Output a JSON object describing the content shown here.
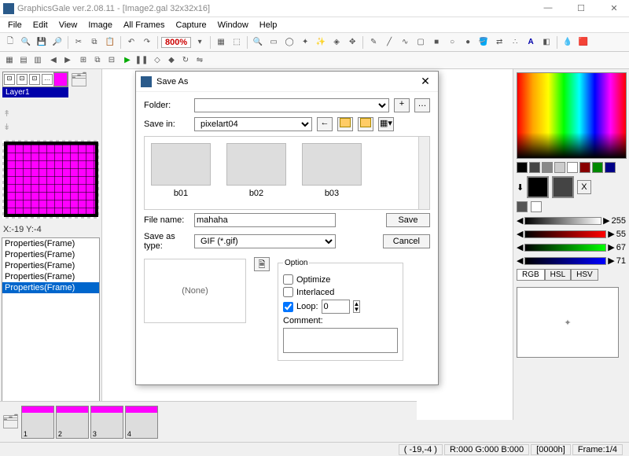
{
  "app": {
    "title": "GraphicsGale ver.2.08.11 - [Image2.gal 32x32x16]"
  },
  "menu": [
    "File",
    "Edit",
    "View",
    "Image",
    "All Frames",
    "Capture",
    "Window",
    "Help"
  ],
  "zoom": "800%",
  "coord": "X:-19 Y:-4",
  "layer": {
    "name": "Layer1"
  },
  "properties": [
    "Properties(Frame)",
    "Properties(Frame)",
    "Properties(Frame)",
    "Properties(Frame)",
    "Properties(Frame)"
  ],
  "frames": [
    "1",
    "2",
    "3",
    "4"
  ],
  "sliders": {
    "v1": "255",
    "v2": "55",
    "v3": "67",
    "v4": "71"
  },
  "colortabs": [
    "RGB",
    "HSL",
    "HSV"
  ],
  "status": {
    "pos": "( -19,-4 )",
    "rgb": "R:000 G:000 B:000",
    "time": "[0000h]",
    "frame": "Frame:1/4"
  },
  "dialog": {
    "title": "Save As",
    "folder_label": "Folder:",
    "savein_label": "Save in:",
    "savein_value": "pixelart04",
    "files": [
      "b01",
      "b02",
      "b03"
    ],
    "filename_label": "File name:",
    "filename_value": "mahaha",
    "type_label": "Save as type:",
    "type_value": "GIF (*.gif)",
    "save_btn": "Save",
    "cancel_btn": "Cancel",
    "none": "(None)",
    "option_label": "Option",
    "optimize": "Optimize",
    "interlaced": "Interlaced",
    "loop": "Loop:",
    "loop_value": "0",
    "comment": "Comment:"
  }
}
